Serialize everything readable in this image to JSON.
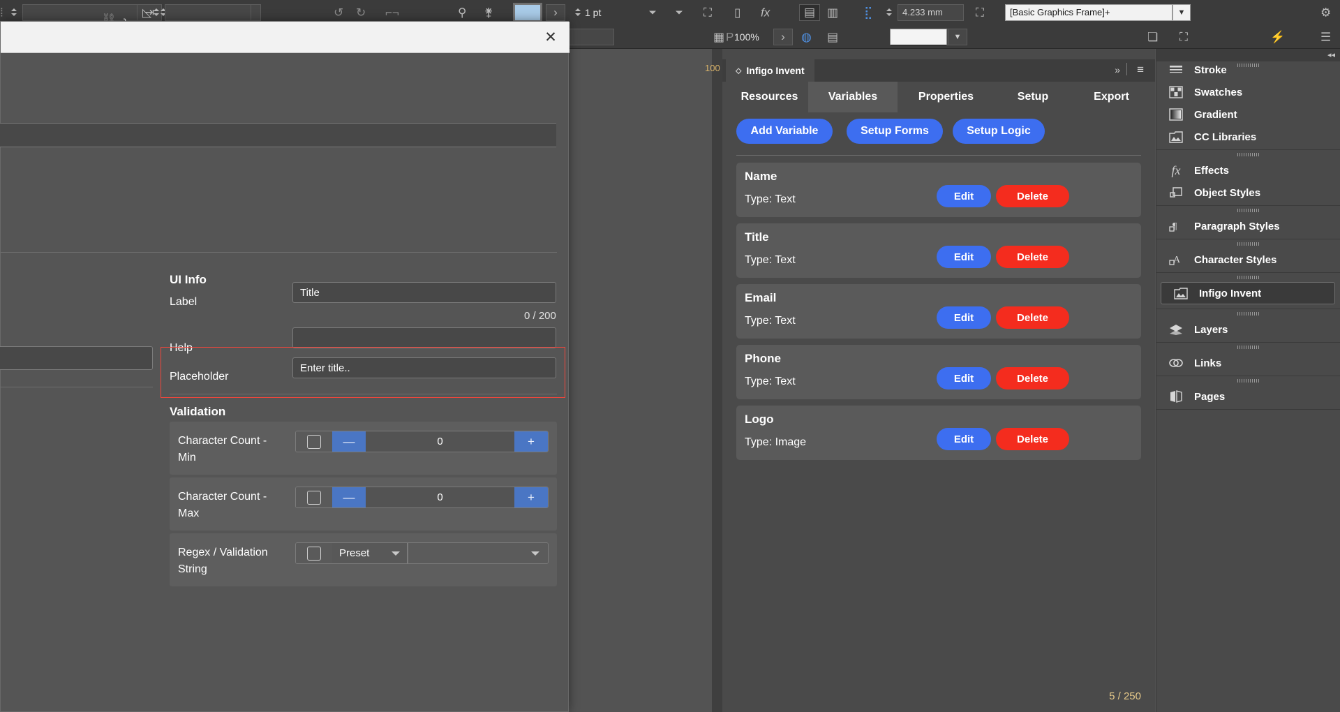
{
  "app": {
    "toolbar": {
      "stroke_weight": "1 pt",
      "gap_value": "4.233 mm",
      "object_style": "[Basic Graphics Frame]+",
      "zoom_level": "100%"
    },
    "ruler_marker": "100"
  },
  "modal": {
    "close_label": "✕",
    "sections": {
      "ui_info_title": "UI Info",
      "validation_title": "Validation"
    },
    "fields": [
      {
        "label": "Label",
        "value": "Title",
        "counter": "0 / 200"
      },
      {
        "label": "Help",
        "value": ""
      },
      {
        "label": "Placeholder",
        "value": "Enter title.."
      }
    ],
    "validation": [
      {
        "label": "Character Count - Min",
        "minus": "—",
        "value": "0",
        "plus": "+"
      },
      {
        "label": "Character Count - Max",
        "minus": "—",
        "value": "0",
        "plus": "+"
      }
    ],
    "regex": {
      "label": "Regex / Validation String",
      "preset": "Preset",
      "value": ""
    }
  },
  "invent": {
    "panel_title": "Infigo Invent",
    "expand_icon": "»",
    "menu_icon": "≡",
    "tabs": [
      {
        "label": "Resources",
        "active": false
      },
      {
        "label": "Variables",
        "active": true
      },
      {
        "label": "Properties",
        "active": false
      },
      {
        "label": "Setup",
        "active": false
      },
      {
        "label": "Export",
        "active": false
      }
    ],
    "actions": [
      {
        "label": "Add Variable"
      },
      {
        "label": "Setup Forms"
      },
      {
        "label": "Setup Logic"
      }
    ],
    "edit_label": "Edit",
    "delete_label": "Delete",
    "variables": [
      {
        "name": "Name",
        "type": "Type: Text",
        "highlighted": false
      },
      {
        "name": "Title",
        "type": "Type: Text",
        "highlighted": true
      },
      {
        "name": "Email",
        "type": "Type: Text",
        "highlighted": false
      },
      {
        "name": "Phone",
        "type": "Type: Text",
        "highlighted": false
      },
      {
        "name": "Logo",
        "type": "Type: Image",
        "highlighted": false
      }
    ],
    "count": "5 / 250"
  },
  "dock": {
    "collapse_icon": "◂◂",
    "items": [
      {
        "label": "Stroke",
        "icon": "stroke-icon",
        "selected": false,
        "group_start": true
      },
      {
        "label": "Swatches",
        "icon": "swatches-icon",
        "selected": false,
        "group_start": false
      },
      {
        "label": "Gradient",
        "icon": "gradient-icon",
        "selected": false,
        "group_start": false
      },
      {
        "label": "CC Libraries",
        "icon": "cc-libraries-icon",
        "selected": false,
        "group_start": false
      },
      {
        "label": "Effects",
        "icon": "effects-fx-icon",
        "selected": false,
        "group_start": true
      },
      {
        "label": "Object Styles",
        "icon": "object-styles-icon",
        "selected": false,
        "group_start": false
      },
      {
        "label": "Paragraph Styles",
        "icon": "paragraph-styles-icon",
        "selected": false,
        "group_start": true
      },
      {
        "label": "Character Styles",
        "icon": "character-styles-icon",
        "selected": false,
        "group_start": true
      },
      {
        "label": "Infigo Invent",
        "icon": "infigo-invent-icon",
        "selected": true,
        "group_start": true
      },
      {
        "label": "Layers",
        "icon": "layers-icon",
        "selected": false,
        "group_start": true
      },
      {
        "label": "Links",
        "icon": "links-icon",
        "selected": false,
        "group_start": true
      },
      {
        "label": "Pages",
        "icon": "pages-icon",
        "selected": false,
        "group_start": true
      }
    ]
  },
  "colors": {
    "accent_blue": "#3d6ef0",
    "danger_red": "#f42c1e",
    "highlight_red": "#f0463c",
    "panel_bg": "#4a4a4a",
    "card_bg": "#5a5a5a"
  }
}
